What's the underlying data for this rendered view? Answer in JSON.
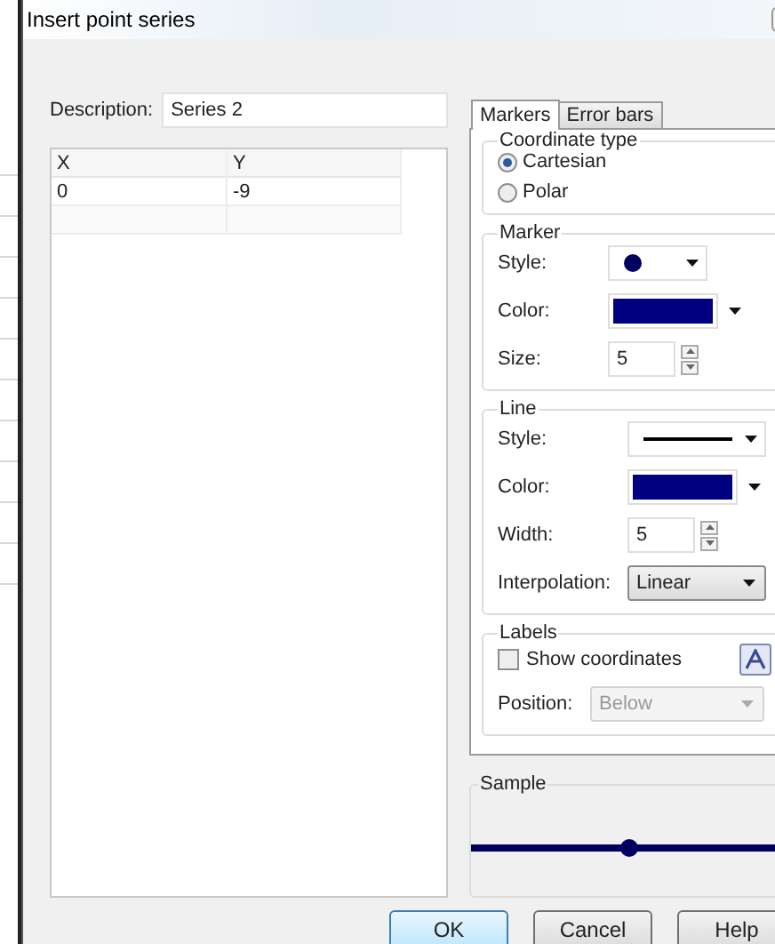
{
  "window": {
    "title": "Insert point series"
  },
  "description": {
    "label": "Description:",
    "value": "Series 2"
  },
  "table": {
    "columns": [
      "X",
      "Y"
    ],
    "rows": [
      [
        "0",
        "-9"
      ]
    ]
  },
  "tabs": [
    {
      "label": "Markers",
      "selected": true
    },
    {
      "label": "Error bars",
      "selected": false
    }
  ],
  "coordinate_type": {
    "title": "Coordinate type",
    "options": [
      {
        "label": "Cartesian",
        "selected": true
      },
      {
        "label": "Polar",
        "selected": false
      }
    ]
  },
  "marker": {
    "title": "Marker",
    "fields": [
      {
        "kind": "marker-style",
        "label": "Style:"
      },
      {
        "kind": "color",
        "label": "Color:",
        "color": "#000080"
      },
      {
        "kind": "spin",
        "label": "Size:",
        "value": "5"
      }
    ]
  },
  "line": {
    "title": "Line",
    "fields": [
      {
        "kind": "line-style",
        "label": "Style:"
      },
      {
        "kind": "color",
        "label": "Color:",
        "color": "#000080"
      },
      {
        "kind": "spin",
        "label": "Width:",
        "value": "5"
      },
      {
        "kind": "select",
        "label": "Interpolation:",
        "value": "Linear"
      }
    ]
  },
  "labels": {
    "title": "Labels",
    "show_coordinates": {
      "label": "Show coordinates",
      "checked": false
    },
    "position": {
      "label": "Position:",
      "value": "Below",
      "disabled": true
    }
  },
  "sample": {
    "title": "Sample"
  },
  "buttons": [
    {
      "label": "OK",
      "default": true
    },
    {
      "label": "Cancel",
      "default": false
    },
    {
      "label": "Help",
      "default": false
    }
  ]
}
